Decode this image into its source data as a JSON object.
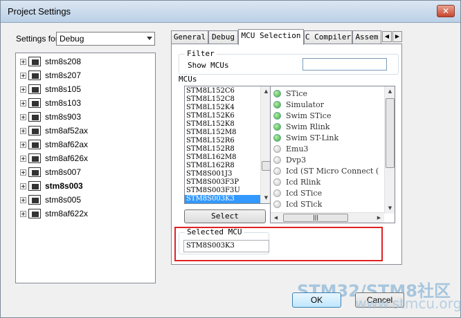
{
  "window": {
    "title": "Project Settings",
    "close_glyph": "✕"
  },
  "settings_for": {
    "label": "Settings for:",
    "value": "Debug"
  },
  "tree": {
    "items": [
      {
        "label": "stm8s208",
        "bold": false
      },
      {
        "label": "stm8s207",
        "bold": false
      },
      {
        "label": "stm8s105",
        "bold": false
      },
      {
        "label": "stm8s103",
        "bold": false
      },
      {
        "label": "stm8s903",
        "bold": false
      },
      {
        "label": "stm8af52ax",
        "bold": false
      },
      {
        "label": "stm8af62ax",
        "bold": false
      },
      {
        "label": "stm8af626x",
        "bold": false
      },
      {
        "label": "stm8s007",
        "bold": false
      },
      {
        "label": "stm8s003",
        "bold": true
      },
      {
        "label": "stm8s005",
        "bold": false
      },
      {
        "label": "stm8af622x",
        "bold": false
      }
    ]
  },
  "tabs": [
    {
      "label": "General",
      "active": false
    },
    {
      "label": "Debug",
      "active": false
    },
    {
      "label": "MCU Selection",
      "active": true
    },
    {
      "label": "C Compiler",
      "active": false
    },
    {
      "label": "Assem",
      "active": false
    }
  ],
  "tab_arrows": {
    "left": "◀",
    "right": "▶"
  },
  "filter": {
    "title": "Filter",
    "show_label": "Show MCUs",
    "value": ""
  },
  "mcus": {
    "title": "MCUs",
    "items": [
      "STM8L152C6",
      "STM8L152C8",
      "STM8L152K4",
      "STM8L152K6",
      "STM8L152K8",
      "STM8L152M8",
      "STM8L152R6",
      "STM8L152R8",
      "STM8L162M8",
      "STM8L162R8",
      "STM8S001J3",
      "STM8S003F3P",
      "STM8S003F3U",
      "STM8S003K3"
    ],
    "selected": "STM8S003K3",
    "select_button": "Select"
  },
  "debuggers": {
    "items": [
      {
        "label": "STice",
        "status": "on"
      },
      {
        "label": "Simulator",
        "status": "on"
      },
      {
        "label": "Swim STice",
        "status": "on"
      },
      {
        "label": "Swim Rlink",
        "status": "on"
      },
      {
        "label": "Swim ST-Link",
        "status": "on"
      },
      {
        "label": "Emu3",
        "status": "off"
      },
      {
        "label": "Dvp3",
        "status": "off"
      },
      {
        "label": "Icd (ST Micro Connect (",
        "status": "off"
      },
      {
        "label": "Icd Rlink",
        "status": "off"
      },
      {
        "label": "Icd STice",
        "status": "off"
      },
      {
        "label": "Icd STick",
        "status": "off"
      }
    ],
    "status_colors": {
      "on": "#3fa832",
      "off": "#c9c9c9"
    }
  },
  "selected_mcu": {
    "title": "Selected MCU",
    "value": "STM8S003K3"
  },
  "buttons": {
    "ok": "OK",
    "cancel": "Cancel"
  },
  "watermark": {
    "line1": "STM32/STM8社区",
    "line2": "www.stmcu.org"
  },
  "colors": {
    "highlight": "#e02020",
    "selection": "#3399ff"
  }
}
